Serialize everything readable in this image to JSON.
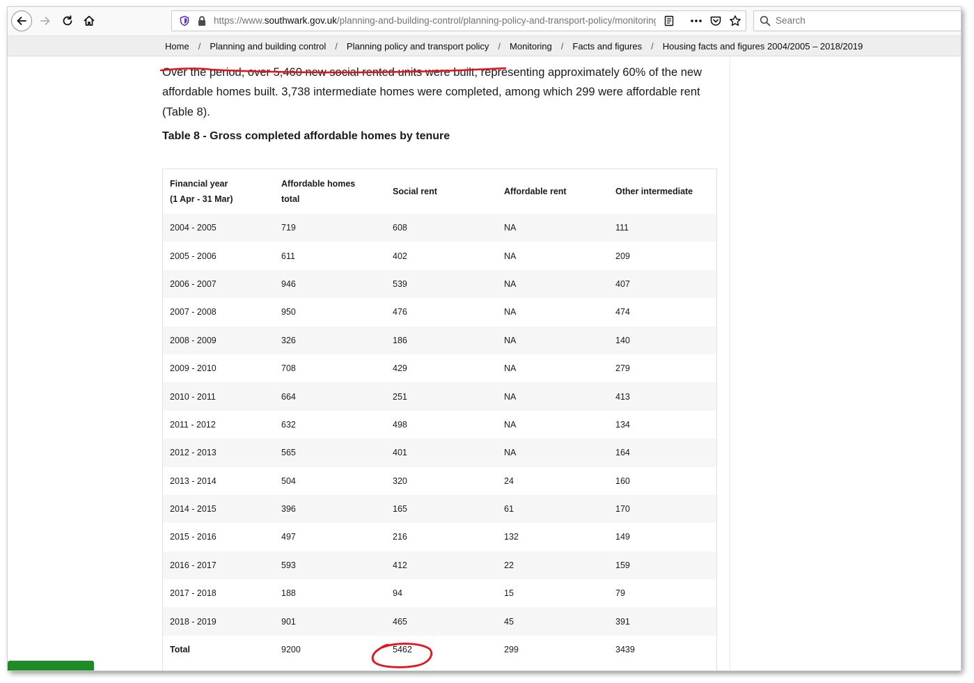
{
  "browser": {
    "url_prefix": "https://www.",
    "url_domain": "southwark.gov.uk",
    "url_path": "/planning-and-building-control/planning-policy-and-transport-policy/monitoring/facts-and-figures",
    "search_placeholder": "Search"
  },
  "breadcrumb": {
    "items": [
      "Home",
      "Planning and building control",
      "Planning policy and transport policy",
      "Monitoring",
      "Facts and figures",
      "Housing facts and figures 2004/2005 – 2018/2019"
    ],
    "separator": "/"
  },
  "intro": {
    "text": "Over the period, over 5,460 new social rented units were built, representing approximately 60% of the new affordable homes built. 3,738 intermediate homes were completed, among which 299 were affordable rent (Table 8)."
  },
  "table": {
    "caption": "Table 8 - Gross completed affordable homes by tenure",
    "headers": {
      "year_line1": "Financial year",
      "year_line2": "(1 Apr - 31 Mar)",
      "total_line1": "Affordable homes",
      "total_line2": "total",
      "social": "Social rent",
      "affordable": "Affordable rent",
      "other": "Other intermediate"
    },
    "rows": [
      [
        "2004 - 2005",
        "719",
        "608",
        "NA",
        "111"
      ],
      [
        "2005 - 2006",
        "611",
        "402",
        "NA",
        "209"
      ],
      [
        "2006 - 2007",
        "946",
        "539",
        "NA",
        "407"
      ],
      [
        "2007 - 2008",
        "950",
        "476",
        "NA",
        "474"
      ],
      [
        "2008 - 2009",
        "326",
        "186",
        "NA",
        "140"
      ],
      [
        "2009 - 2010",
        "708",
        "429",
        "NA",
        "279"
      ],
      [
        "2010 - 2011",
        "664",
        "251",
        "NA",
        "413"
      ],
      [
        "2011 - 2012",
        "632",
        "498",
        "NA",
        "134"
      ],
      [
        "2012 - 2013",
        "565",
        "401",
        "NA",
        "164"
      ],
      [
        "2013 - 2014",
        "504",
        "320",
        "24",
        "160"
      ],
      [
        "2014 - 2015",
        "396",
        "165",
        "61",
        "170"
      ],
      [
        "2015 - 2016",
        "497",
        "216",
        "132",
        "149"
      ],
      [
        "2016 - 2017",
        "593",
        "412",
        "22",
        "159"
      ],
      [
        "2017 - 2018",
        "188",
        "94",
        "15",
        "79"
      ],
      [
        "2018 - 2019",
        "901",
        "465",
        "45",
        "391"
      ]
    ],
    "total_row": [
      "Total",
      "9200",
      "5462",
      "299",
      "3439"
    ]
  },
  "colors": {
    "annotation": "#e8101a",
    "green_tab": "#1f8b24"
  }
}
